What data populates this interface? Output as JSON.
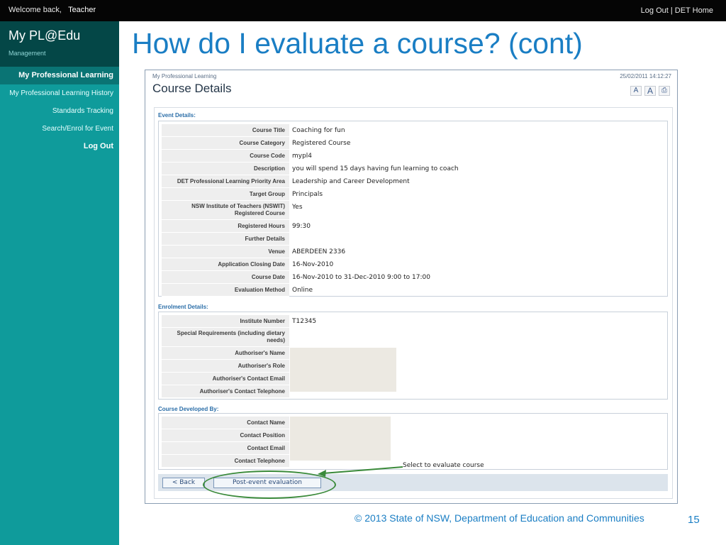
{
  "topbar": {
    "welcome": "Welcome back,",
    "user": "Teacher",
    "logout_link": "Log Out",
    "separator": " | ",
    "home_link": "DET Home"
  },
  "sidebar": {
    "brand": "My PL@Edu",
    "subtitle": "Management",
    "items": [
      {
        "label": "My Professional Learning"
      },
      {
        "label": "My Professional Learning History"
      },
      {
        "label": "Standards Tracking"
      },
      {
        "label": "Search/Enrol for Event"
      }
    ],
    "logout": "Log Out"
  },
  "slide_title": "How do I evaluate a course? (cont)",
  "panel": {
    "breadcrumb": "My Professional Learning",
    "timestamp": "25/02/2011 14:12:27",
    "heading": "Course Details",
    "text_small": "A",
    "text_large": "A",
    "print_icon": "print-icon"
  },
  "event": {
    "section_title": "Event Details:",
    "rows": [
      {
        "label": "Course Title",
        "value": "Coaching for fun"
      },
      {
        "label": "Course Category",
        "value": "Registered Course"
      },
      {
        "label": "Course Code",
        "value": "mypl4"
      },
      {
        "label": "Description",
        "value": "you will spend 15 days having fun learning to coach"
      },
      {
        "label": "DET Professional Learning Priority Area",
        "value": "Leadership and Career Development"
      },
      {
        "label": "Target Group",
        "value": "Principals"
      },
      {
        "label": "NSW Institute of Teachers (NSWIT) Registered Course",
        "value": "Yes"
      },
      {
        "label": "Registered Hours",
        "value": "99:30"
      },
      {
        "label": "Further Details",
        "value": ""
      },
      {
        "label": "Venue",
        "value": "ABERDEEN 2336"
      },
      {
        "label": "Application Closing Date",
        "value": "16-Nov-2010"
      },
      {
        "label": "Course Date",
        "value": "16-Nov-2010 to 31-Dec-2010  9:00 to 17:00"
      },
      {
        "label": "Evaluation Method",
        "value": "Online"
      }
    ]
  },
  "enrolment": {
    "section_title": "Enrolment Details:",
    "rows": [
      {
        "label": "Institute Number",
        "value": "T12345"
      },
      {
        "label": "Special Requirements (including dietary needs)",
        "value": ""
      },
      {
        "label": "Authoriser's Name",
        "value": ""
      },
      {
        "label": "Authoriser's Role",
        "value": ""
      },
      {
        "label": "Authoriser's Contact Email",
        "value": ""
      },
      {
        "label": "Authoriser's Contact Telephone",
        "value": ""
      }
    ]
  },
  "developed_by": {
    "section_title": "Course Developed By:",
    "rows": [
      {
        "label": "Contact Name",
        "value": ""
      },
      {
        "label": "Contact Position",
        "value": ""
      },
      {
        "label": "Contact Email",
        "value": ""
      },
      {
        "label": "Contact Telephone",
        "value": ""
      }
    ]
  },
  "buttons": {
    "back": "< Back",
    "evaluate": "Post-event evaluation"
  },
  "callout": "Select to evaluate course",
  "footer": "© 2013 State of NSW, Department of Education and Communities",
  "page_number": "15",
  "colors": {
    "accent": "#1a7ec4",
    "sidebar": "#0f9b9b",
    "highlight": "#3a8a3a"
  }
}
